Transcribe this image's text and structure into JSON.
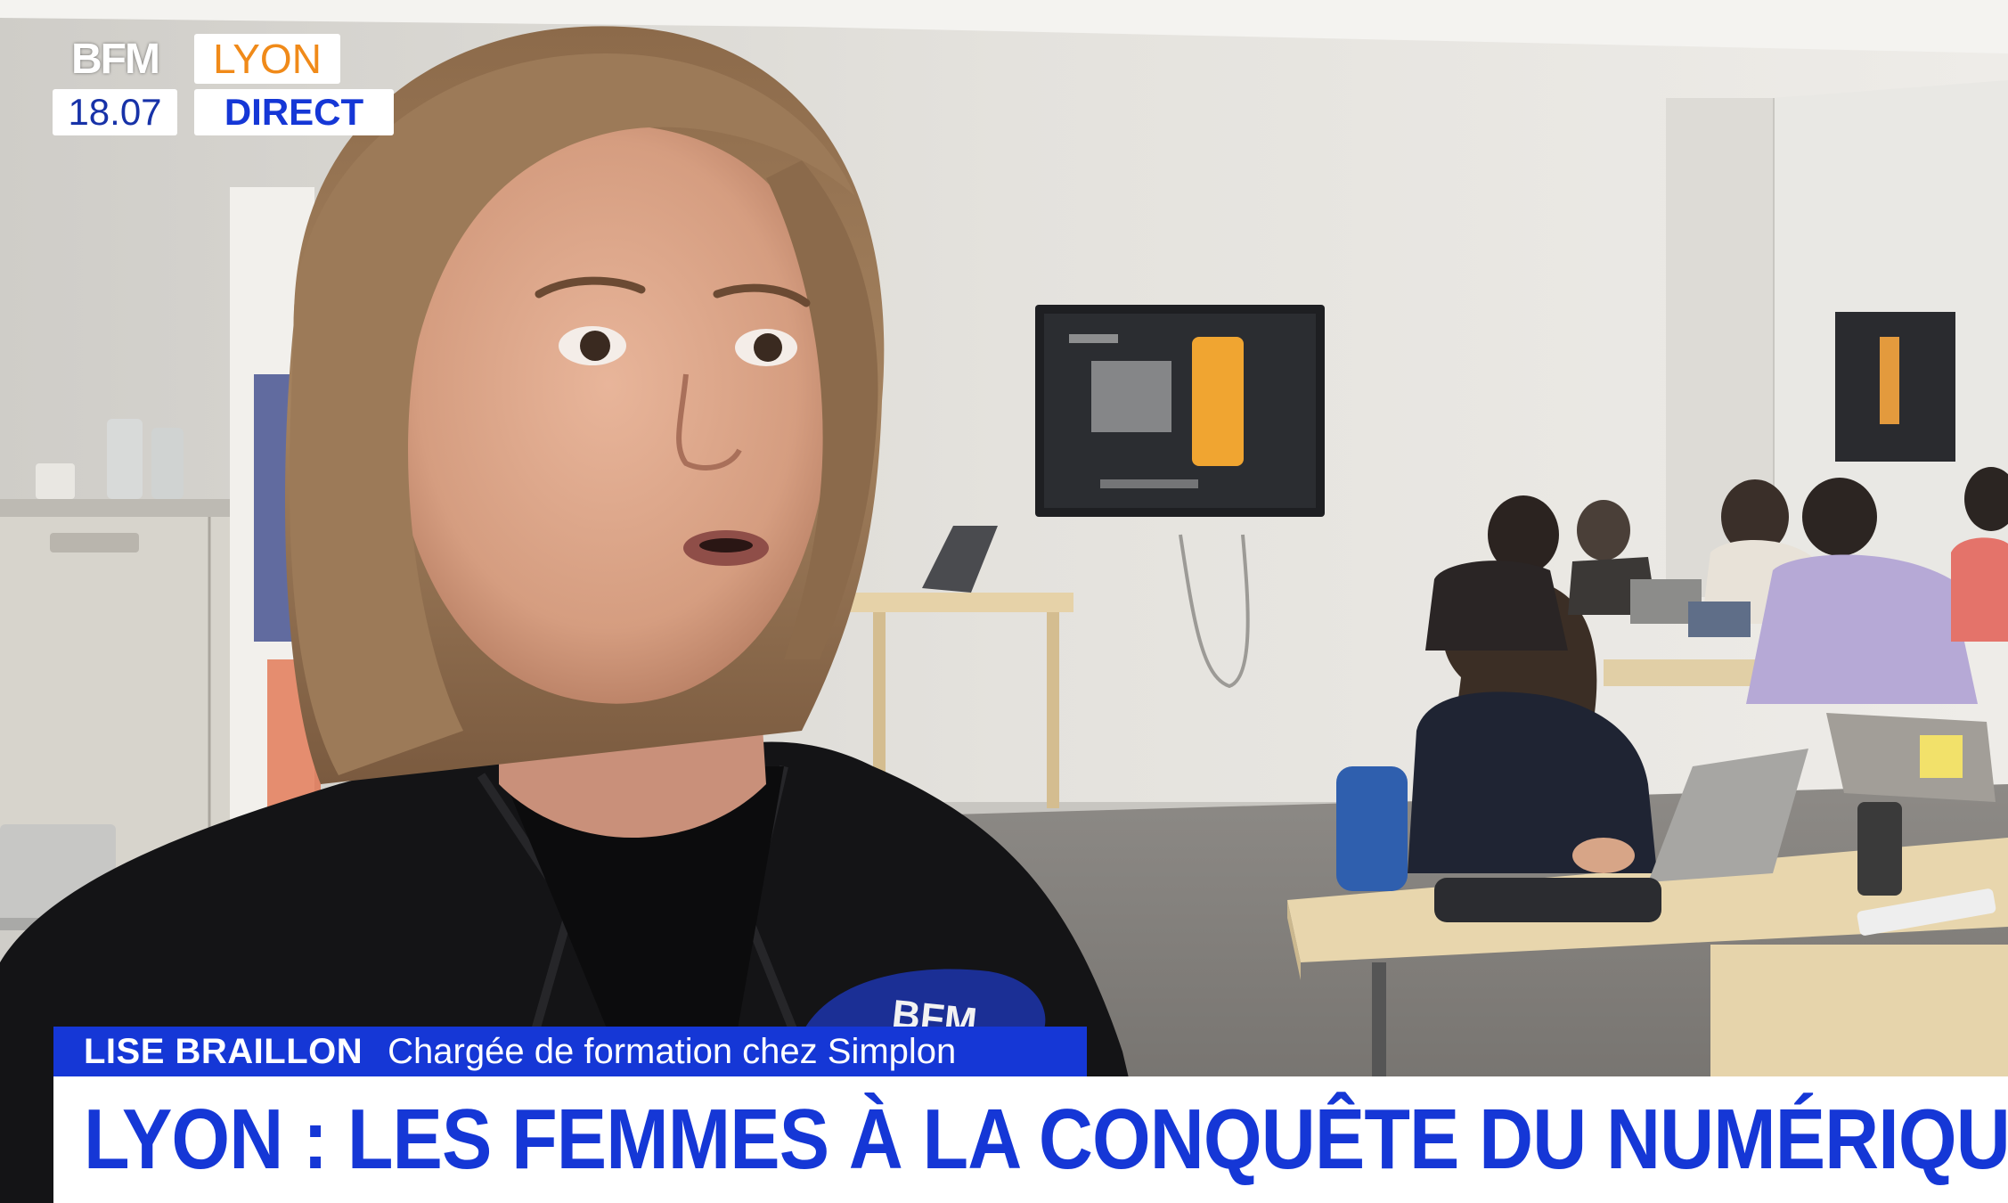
{
  "channel": {
    "logo_text": "BFM",
    "city": "LYON",
    "time": "18.07",
    "live_label": "DIRECT",
    "brand_blue": "#1537d6",
    "city_orange": "#f08a19"
  },
  "lower_third": {
    "name": "LISE BRAILLON",
    "role": "Chargée de formation chez Simplon",
    "headline": "LYON : LES FEMMES À LA CONQUÊTE DU NUMÉRIQUE"
  },
  "microphone": {
    "logo_text": "BFM"
  }
}
